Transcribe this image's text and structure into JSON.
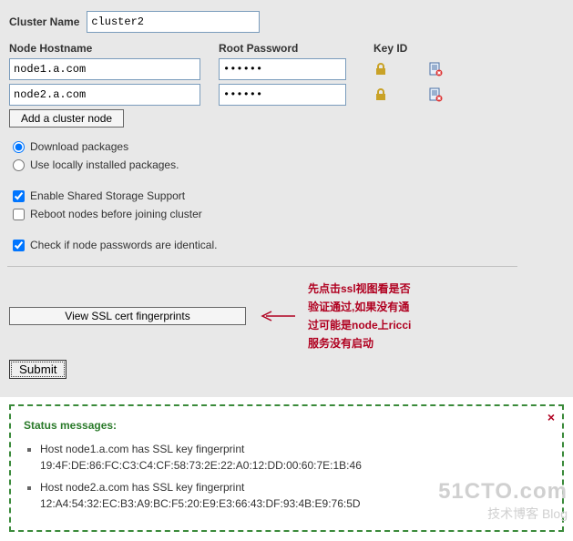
{
  "form": {
    "cluster_name_label": "Cluster Name",
    "cluster_name_value": "cluster2",
    "columns": {
      "hostname": "Node Hostname",
      "password": "Root Password",
      "key_id": "Key ID"
    },
    "nodes": [
      {
        "hostname": "node1.a.com",
        "password": "••••••"
      },
      {
        "hostname": "node2.a.com",
        "password": "••••••"
      }
    ],
    "add_node_label": "Add a cluster node"
  },
  "options": {
    "download_packages": {
      "label": "Download packages",
      "checked": true
    },
    "use_local": {
      "label": "Use locally installed packages.",
      "checked": false
    },
    "shared_storage": {
      "label": "Enable Shared Storage Support",
      "checked": true
    },
    "reboot_nodes": {
      "label": "Reboot nodes before joining cluster",
      "checked": false
    },
    "check_passwords": {
      "label": "Check if node passwords are identical.",
      "checked": true
    }
  },
  "actions": {
    "view_ssl_label": "View SSL cert fingerprints",
    "submit_label": "Submit"
  },
  "annotation": {
    "line1": "先点击ssl视图看是否",
    "line2": "验证通过,如果没有通",
    "line3": "过可能是node上ricci",
    "line4": "服务没有启动"
  },
  "status": {
    "title": "Status messages:",
    "messages": [
      "Host node1.a.com has SSL key fingerprint 19:4F:DE:86:FC:C3:C4:CF:58:73:2E:22:A0:12:DD:00:60:7E:1B:46",
      "Host node2.a.com has SSL key fingerprint 12:A4:54:32:EC:B3:A9:BC:F5:20:E9:E3:66:43:DF:93:4B:E9:76:5D"
    ]
  },
  "watermark": {
    "line1": "51CTO.com",
    "line2": "技术博客    Blog"
  }
}
